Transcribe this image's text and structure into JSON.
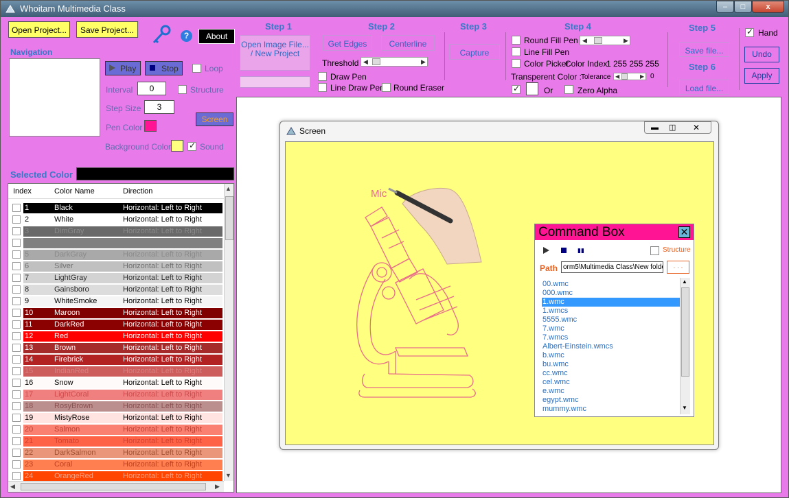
{
  "title": "Whoitam Multimedia Class",
  "titlebar_buttons": [
    "–",
    "□",
    "x"
  ],
  "top": {
    "open_project": "Open Project...",
    "save_project": "Save Project...",
    "about": "About",
    "help_glyph": "?"
  },
  "navigation": {
    "heading": "Navigation",
    "play": "Play",
    "stop": "Stop",
    "loop": "Loop",
    "interval_label": "Interval",
    "interval_value": "0",
    "structure": "Structure",
    "step_size_label": "Step Size",
    "step_size_value": "3",
    "pen_color_label": "Pen Color",
    "screen": "Screen",
    "background_color_label": "Background Color",
    "sound": "Sound"
  },
  "selected_color_label": "Selected Color",
  "steps": {
    "step1": "Step 1",
    "open_image": "Open Image File... / New Project",
    "step2": "Step 2",
    "get_edges": "Get Edges",
    "centerline": "Centerline",
    "threshold": "Threshold",
    "draw_pen": "Draw Pen",
    "line_draw_pen": "Line Draw Pen",
    "round_eraser": "Round Eraser",
    "step3": "Step 3",
    "capture": "Capture",
    "step4": "Step 4",
    "round_fill_pen": "Round Fill Pen",
    "line_fill_pen": "Line Fill Pen",
    "color_picker": "Color Picker",
    "color_index_label": "Color Index",
    "color_index_value": "1 255 255 255",
    "transparent_color": "Transperent Color :",
    "tolerance": "Tolerance",
    "tolerance_value": "0",
    "or": "Or",
    "zero_alpha": "Zero Alpha",
    "step5": "Step 5",
    "save_file": "Save file...",
    "step6": "Step 6",
    "load_file": "Load  file...",
    "hand": "Hand",
    "undo": "Undo",
    "apply": "Apply"
  },
  "colors": {
    "pen": "#ff1493",
    "background": "#ffff80",
    "window_bg": "#e97ae9",
    "accent_blue": "#3a78c8"
  },
  "list": {
    "headers": [
      "Index",
      "Color Name",
      "Direction"
    ],
    "rows": [
      {
        "i": "1",
        "name": "Black",
        "dir": "Horizontal: Left to Right",
        "bg": "#000000",
        "fg": "#ffffff"
      },
      {
        "i": "2",
        "name": "White",
        "dir": "Horizontal: Left to Right",
        "bg": "#ffffff",
        "fg": "#000000"
      },
      {
        "i": "3",
        "name": "DimGray",
        "dir": "Horizontal: Left to Right",
        "bg": "#696969",
        "fg": "#8a8a8a"
      },
      {
        "i": "",
        "name": "",
        "dir": "",
        "bg": "#808080",
        "fg": "#000000"
      },
      {
        "i": "5",
        "name": "DarkGray",
        "dir": "Horizontal: Left to Right",
        "bg": "#a9a9a9",
        "fg": "#8a8a8a"
      },
      {
        "i": "6",
        "name": "Silver",
        "dir": "Horizontal: Left to Right",
        "bg": "#c0c0c0",
        "fg": "#6f6f6f"
      },
      {
        "i": "7",
        "name": "LightGray",
        "dir": "Horizontal: Left to Right",
        "bg": "#d3d3d3",
        "fg": "#333333"
      },
      {
        "i": "8",
        "name": "Gainsboro",
        "dir": "Horizontal: Left to Right",
        "bg": "#dcdcdc",
        "fg": "#222222"
      },
      {
        "i": "9",
        "name": "WhiteSmoke",
        "dir": "Horizontal: Left to Right",
        "bg": "#f5f5f5",
        "fg": "#000000"
      },
      {
        "i": "10",
        "name": "Maroon",
        "dir": "Horizontal: Left to Right",
        "bg": "#800000",
        "fg": "#ffffff"
      },
      {
        "i": "11",
        "name": "DarkRed",
        "dir": "Horizontal: Left to Right",
        "bg": "#8b0000",
        "fg": "#ffffff"
      },
      {
        "i": "12",
        "name": "Red",
        "dir": "Horizontal: Left to Right",
        "bg": "#ff0000",
        "fg": "#ffffff"
      },
      {
        "i": "13",
        "name": "Brown",
        "dir": "Horizontal: Left to Right",
        "bg": "#a52a2a",
        "fg": "#ffffff"
      },
      {
        "i": "14",
        "name": "Firebrick",
        "dir": "Horizontal: Left to Right",
        "bg": "#b22222",
        "fg": "#ffffff"
      },
      {
        "i": "15",
        "name": "IndianRed",
        "dir": "Horizontal: Left to Right",
        "bg": "#cd5c5c",
        "fg": "#d98080"
      },
      {
        "i": "16",
        "name": "Snow",
        "dir": "Horizontal: Left to Right",
        "bg": "#fffafa",
        "fg": "#000000"
      },
      {
        "i": "17",
        "name": "LightCoral",
        "dir": "Horizontal: Left to Right",
        "bg": "#f08080",
        "fg": "#d04a4a"
      },
      {
        "i": "18",
        "name": "RosyBrown",
        "dir": "Horizontal: Left to Right",
        "bg": "#bc8f8f",
        "fg": "#8a5050"
      },
      {
        "i": "19",
        "name": "MistyRose",
        "dir": "Horizontal: Left to Right",
        "bg": "#ffe4e1",
        "fg": "#000000"
      },
      {
        "i": "20",
        "name": "Salmon",
        "dir": "Horizontal: Left to Right",
        "bg": "#fa8072",
        "fg": "#c04030"
      },
      {
        "i": "21",
        "name": "Tomato",
        "dir": "Horizontal: Left to Right",
        "bg": "#ff6347",
        "fg": "#d04030"
      },
      {
        "i": "22",
        "name": "DarkSalmon",
        "dir": "Horizontal: Left to Right",
        "bg": "#e9967a",
        "fg": "#a05030"
      },
      {
        "i": "23",
        "name": "Coral",
        "dir": "Horizontal: Left to Right",
        "bg": "#ff7f50",
        "fg": "#c04020"
      },
      {
        "i": "24",
        "name": "OrangeRed",
        "dir": "Horizontal: Left to Right",
        "bg": "#ff4500",
        "fg": "#ffa080"
      }
    ]
  },
  "screen_window": {
    "title": "Screen",
    "drawing_text": "Mic"
  },
  "command_box": {
    "title": "Command Box",
    "structure": "Structure",
    "path_label": "Path",
    "path_value": "orm5\\Multimedia Class\\New folder",
    "browse": ". . .",
    "files": [
      "00.wmc",
      "000.wmc",
      "1.wmc",
      "1.wmcs",
      "5555.wmc",
      "7.wmc",
      "7.wmcs",
      "Albert-Einstein.wmcs",
      "b.wmc",
      "bu.wmc",
      "cc.wmc",
      "cel.wmc",
      "e.wmc",
      "egypt.wmc",
      "mummy.wmc"
    ],
    "selected_index": 2
  }
}
